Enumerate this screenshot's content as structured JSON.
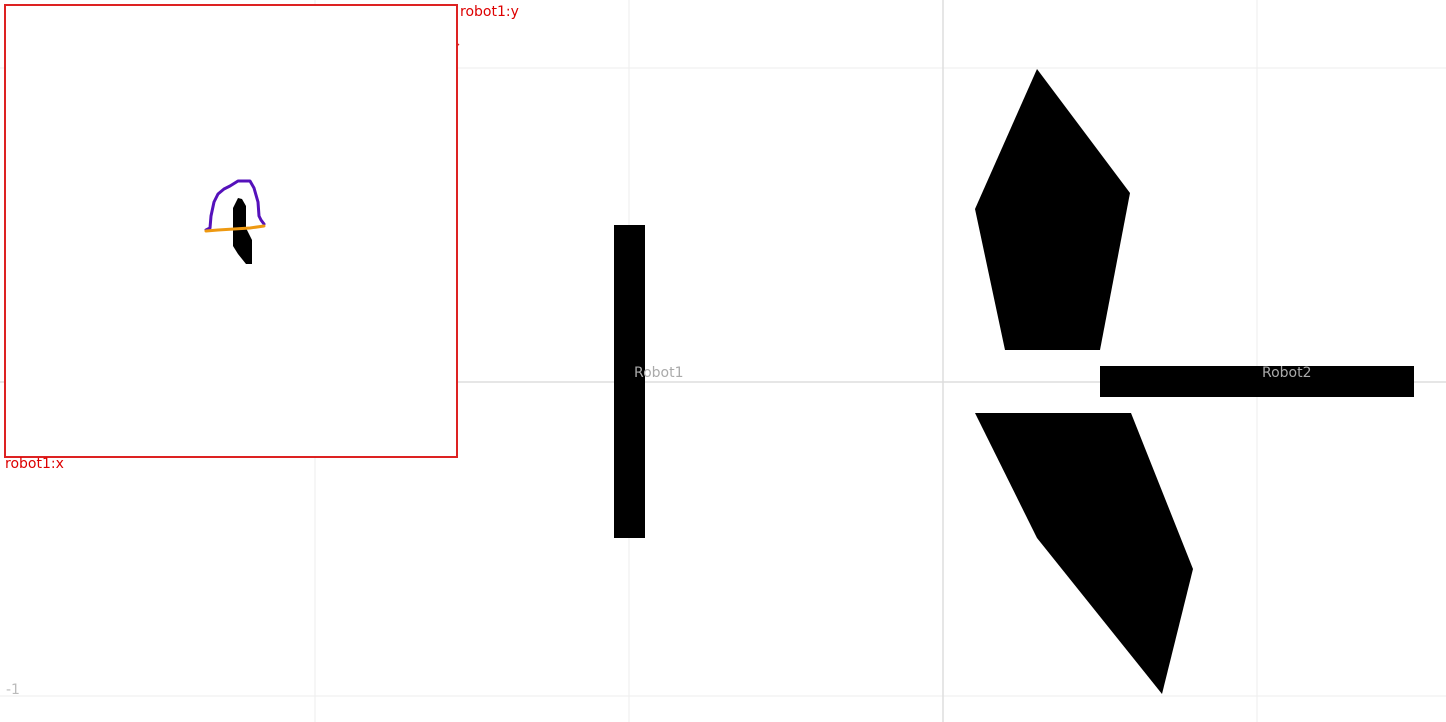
{
  "world": {
    "tick_label": "-1",
    "robots": [
      {
        "label": "Robot1"
      },
      {
        "label": "Robot2"
      }
    ],
    "colors": {
      "background": "#ffffff",
      "grid": "#eeeeee",
      "axis": "#dddddd",
      "obstacle": "#000000",
      "robot_label": "#aaaaaa"
    }
  },
  "inset": {
    "x_label": "robot1:x",
    "y_label": "robot1:y",
    "colors": {
      "frame": "#dd2222",
      "label": "#dd0000",
      "curve_upper": "#5511bb",
      "curve_lower": "#ee9911",
      "blob": "#000000"
    }
  }
}
